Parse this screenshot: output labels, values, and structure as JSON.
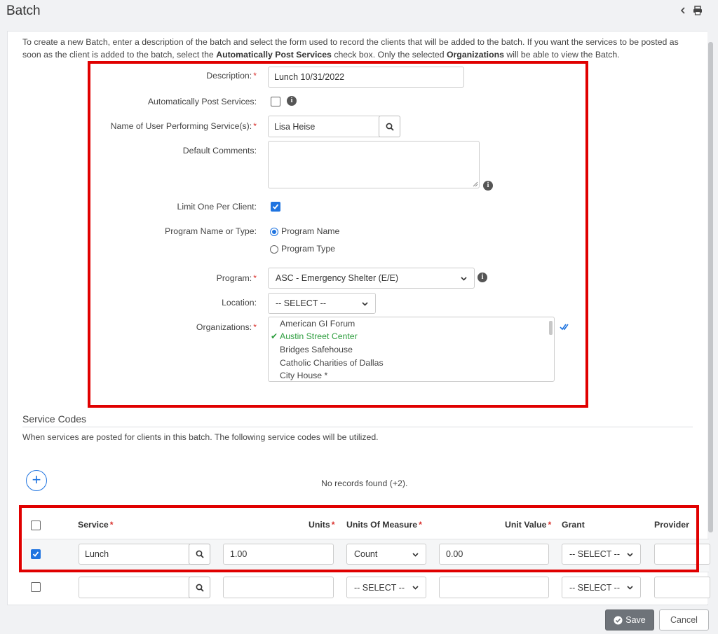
{
  "header": {
    "title": "Batch"
  },
  "intro": {
    "part1": "To create a new Batch, enter a description of the batch and select the form used to record the clients that will be added to the batch.  If you want the services to be posted as soon as the client is added to the batch, select the ",
    "bold1": "Automatically Post Services",
    "part2": " check box.  Only the selected ",
    "bold2": "Organizations",
    "part3": " will be able to view the Batch."
  },
  "form": {
    "description": {
      "label": "Description:",
      "value": "Lunch 10/31/2022"
    },
    "auto_post": {
      "label": "Automatically Post Services:",
      "checked": false
    },
    "user": {
      "label": "Name of User Performing Service(s):",
      "value": "Lisa Heise"
    },
    "comments": {
      "label": "Default Comments:",
      "value": ""
    },
    "limit_one": {
      "label": "Limit One Per Client:",
      "checked": true
    },
    "program_mode": {
      "label": "Program Name or Type:",
      "options": [
        "Program Name",
        "Program Type"
      ],
      "selected": "Program Name"
    },
    "program": {
      "label": "Program:",
      "value": "ASC - Emergency Shelter (E/E)"
    },
    "location": {
      "label": "Location:",
      "value": "-- SELECT --"
    },
    "organizations": {
      "label": "Organizations:",
      "items": [
        "American GI Forum",
        "Austin Street Center",
        "Bridges Safehouse",
        "Catholic Charities of Dallas",
        "City House *"
      ],
      "selected": "Austin Street Center"
    },
    "required_mark": "*"
  },
  "service_codes": {
    "title": "Service Codes",
    "description": "When services are posted for clients in this batch. The following service codes will be utilized.",
    "no_records": "No records found (+2).",
    "columns": {
      "service": "Service",
      "units": "Units",
      "uom": "Units Of Measure",
      "unit_value": "Unit Value",
      "grant": "Grant",
      "provider": "Provider"
    },
    "rows": [
      {
        "checked": true,
        "service": "Lunch",
        "units": "1.00",
        "uom": "Count",
        "unit_value": "0.00",
        "grant": "-- SELECT --",
        "provider": ""
      },
      {
        "checked": false,
        "service": "",
        "units": "",
        "uom": "-- SELECT --",
        "unit_value": "",
        "grant": "-- SELECT --",
        "provider": ""
      }
    ]
  },
  "footer": {
    "save_label": "Save",
    "cancel_label": "Cancel"
  },
  "colors": {
    "accent": "#1f74e0",
    "required": "#d9302c",
    "selected_org": "#2e9e3f",
    "highlight": "#e00000"
  }
}
